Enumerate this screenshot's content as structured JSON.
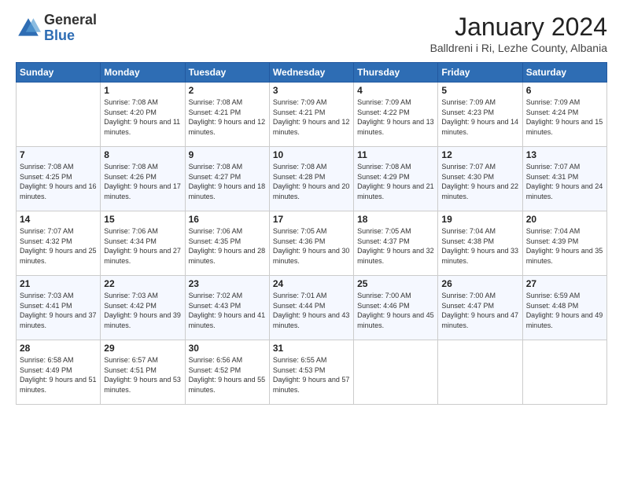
{
  "logo": {
    "general": "General",
    "blue": "Blue"
  },
  "header": {
    "title": "January 2024",
    "subtitle": "Balldreni i Ri, Lezhe County, Albania"
  },
  "weekdays": [
    "Sunday",
    "Monday",
    "Tuesday",
    "Wednesday",
    "Thursday",
    "Friday",
    "Saturday"
  ],
  "weeks": [
    [
      {
        "day": "",
        "sunrise": "",
        "sunset": "",
        "daylight": ""
      },
      {
        "day": "1",
        "sunrise": "Sunrise: 7:08 AM",
        "sunset": "Sunset: 4:20 PM",
        "daylight": "Daylight: 9 hours and 11 minutes."
      },
      {
        "day": "2",
        "sunrise": "Sunrise: 7:08 AM",
        "sunset": "Sunset: 4:21 PM",
        "daylight": "Daylight: 9 hours and 12 minutes."
      },
      {
        "day": "3",
        "sunrise": "Sunrise: 7:09 AM",
        "sunset": "Sunset: 4:21 PM",
        "daylight": "Daylight: 9 hours and 12 minutes."
      },
      {
        "day": "4",
        "sunrise": "Sunrise: 7:09 AM",
        "sunset": "Sunset: 4:22 PM",
        "daylight": "Daylight: 9 hours and 13 minutes."
      },
      {
        "day": "5",
        "sunrise": "Sunrise: 7:09 AM",
        "sunset": "Sunset: 4:23 PM",
        "daylight": "Daylight: 9 hours and 14 minutes."
      },
      {
        "day": "6",
        "sunrise": "Sunrise: 7:09 AM",
        "sunset": "Sunset: 4:24 PM",
        "daylight": "Daylight: 9 hours and 15 minutes."
      }
    ],
    [
      {
        "day": "7",
        "sunrise": "Sunrise: 7:08 AM",
        "sunset": "Sunset: 4:25 PM",
        "daylight": "Daylight: 9 hours and 16 minutes."
      },
      {
        "day": "8",
        "sunrise": "Sunrise: 7:08 AM",
        "sunset": "Sunset: 4:26 PM",
        "daylight": "Daylight: 9 hours and 17 minutes."
      },
      {
        "day": "9",
        "sunrise": "Sunrise: 7:08 AM",
        "sunset": "Sunset: 4:27 PM",
        "daylight": "Daylight: 9 hours and 18 minutes."
      },
      {
        "day": "10",
        "sunrise": "Sunrise: 7:08 AM",
        "sunset": "Sunset: 4:28 PM",
        "daylight": "Daylight: 9 hours and 20 minutes."
      },
      {
        "day": "11",
        "sunrise": "Sunrise: 7:08 AM",
        "sunset": "Sunset: 4:29 PM",
        "daylight": "Daylight: 9 hours and 21 minutes."
      },
      {
        "day": "12",
        "sunrise": "Sunrise: 7:07 AM",
        "sunset": "Sunset: 4:30 PM",
        "daylight": "Daylight: 9 hours and 22 minutes."
      },
      {
        "day": "13",
        "sunrise": "Sunrise: 7:07 AM",
        "sunset": "Sunset: 4:31 PM",
        "daylight": "Daylight: 9 hours and 24 minutes."
      }
    ],
    [
      {
        "day": "14",
        "sunrise": "Sunrise: 7:07 AM",
        "sunset": "Sunset: 4:32 PM",
        "daylight": "Daylight: 9 hours and 25 minutes."
      },
      {
        "day": "15",
        "sunrise": "Sunrise: 7:06 AM",
        "sunset": "Sunset: 4:34 PM",
        "daylight": "Daylight: 9 hours and 27 minutes."
      },
      {
        "day": "16",
        "sunrise": "Sunrise: 7:06 AM",
        "sunset": "Sunset: 4:35 PM",
        "daylight": "Daylight: 9 hours and 28 minutes."
      },
      {
        "day": "17",
        "sunrise": "Sunrise: 7:05 AM",
        "sunset": "Sunset: 4:36 PM",
        "daylight": "Daylight: 9 hours and 30 minutes."
      },
      {
        "day": "18",
        "sunrise": "Sunrise: 7:05 AM",
        "sunset": "Sunset: 4:37 PM",
        "daylight": "Daylight: 9 hours and 32 minutes."
      },
      {
        "day": "19",
        "sunrise": "Sunrise: 7:04 AM",
        "sunset": "Sunset: 4:38 PM",
        "daylight": "Daylight: 9 hours and 33 minutes."
      },
      {
        "day": "20",
        "sunrise": "Sunrise: 7:04 AM",
        "sunset": "Sunset: 4:39 PM",
        "daylight": "Daylight: 9 hours and 35 minutes."
      }
    ],
    [
      {
        "day": "21",
        "sunrise": "Sunrise: 7:03 AM",
        "sunset": "Sunset: 4:41 PM",
        "daylight": "Daylight: 9 hours and 37 minutes."
      },
      {
        "day": "22",
        "sunrise": "Sunrise: 7:03 AM",
        "sunset": "Sunset: 4:42 PM",
        "daylight": "Daylight: 9 hours and 39 minutes."
      },
      {
        "day": "23",
        "sunrise": "Sunrise: 7:02 AM",
        "sunset": "Sunset: 4:43 PM",
        "daylight": "Daylight: 9 hours and 41 minutes."
      },
      {
        "day": "24",
        "sunrise": "Sunrise: 7:01 AM",
        "sunset": "Sunset: 4:44 PM",
        "daylight": "Daylight: 9 hours and 43 minutes."
      },
      {
        "day": "25",
        "sunrise": "Sunrise: 7:00 AM",
        "sunset": "Sunset: 4:46 PM",
        "daylight": "Daylight: 9 hours and 45 minutes."
      },
      {
        "day": "26",
        "sunrise": "Sunrise: 7:00 AM",
        "sunset": "Sunset: 4:47 PM",
        "daylight": "Daylight: 9 hours and 47 minutes."
      },
      {
        "day": "27",
        "sunrise": "Sunrise: 6:59 AM",
        "sunset": "Sunset: 4:48 PM",
        "daylight": "Daylight: 9 hours and 49 minutes."
      }
    ],
    [
      {
        "day": "28",
        "sunrise": "Sunrise: 6:58 AM",
        "sunset": "Sunset: 4:49 PM",
        "daylight": "Daylight: 9 hours and 51 minutes."
      },
      {
        "day": "29",
        "sunrise": "Sunrise: 6:57 AM",
        "sunset": "Sunset: 4:51 PM",
        "daylight": "Daylight: 9 hours and 53 minutes."
      },
      {
        "day": "30",
        "sunrise": "Sunrise: 6:56 AM",
        "sunset": "Sunset: 4:52 PM",
        "daylight": "Daylight: 9 hours and 55 minutes."
      },
      {
        "day": "31",
        "sunrise": "Sunrise: 6:55 AM",
        "sunset": "Sunset: 4:53 PM",
        "daylight": "Daylight: 9 hours and 57 minutes."
      },
      {
        "day": "",
        "sunrise": "",
        "sunset": "",
        "daylight": ""
      },
      {
        "day": "",
        "sunrise": "",
        "sunset": "",
        "daylight": ""
      },
      {
        "day": "",
        "sunrise": "",
        "sunset": "",
        "daylight": ""
      }
    ]
  ]
}
